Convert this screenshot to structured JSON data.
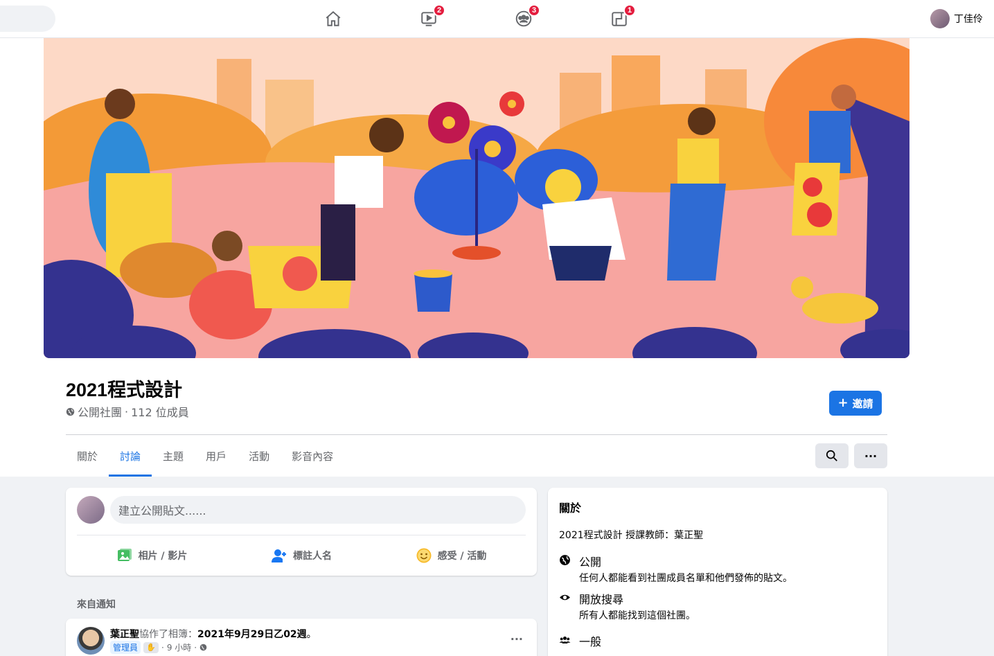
{
  "nav": {
    "video_badge": "2",
    "groups_badge": "3",
    "gaming_badge": "1",
    "user_name": "丁佳伶",
    "icons": [
      "home-icon",
      "video-icon",
      "groups-icon",
      "gaming-icon"
    ]
  },
  "group": {
    "title": "2021程式設計",
    "privacy": "公開社團",
    "member_count": "112 位成員",
    "invite_label": "邀請"
  },
  "tabs": [
    "關於",
    "討論",
    "主題",
    "用戶",
    "活動",
    "影音內容"
  ],
  "active_tab": "討論",
  "composer": {
    "placeholder": "建立公開貼文......",
    "actions": [
      {
        "label": "相片 / 影片",
        "icon": "photo-icon",
        "color": "#45bd62"
      },
      {
        "label": "標註人名",
        "icon": "tag-people-icon",
        "color": "#1877f2"
      },
      {
        "label": "感受 / 活動",
        "icon": "feeling-icon",
        "color": "#f7b928"
      }
    ]
  },
  "notifications": {
    "label": "來自通知",
    "post": {
      "author": "葉正聖",
      "action": "協作了相簿：",
      "album": "2021年9月29日乙02週",
      "suffix": "。",
      "role": "管理員",
      "time": "9 小時"
    }
  },
  "about": {
    "title": "關於",
    "description": "2021程式設計 授課教師：葉正聖",
    "items": [
      {
        "title": "公開",
        "subtitle": "任何人都能看到社團成員名單和他們發佈的貼文。",
        "icon": "globe-icon"
      },
      {
        "title": "開放搜尋",
        "subtitle": "所有人都能找到這個社團。",
        "icon": "eye-icon"
      },
      {
        "title": "一般",
        "subtitle": "",
        "icon": "people-icon"
      }
    ]
  },
  "colors": {
    "accent": "#1b74e4",
    "badge": "#e41e3f"
  }
}
